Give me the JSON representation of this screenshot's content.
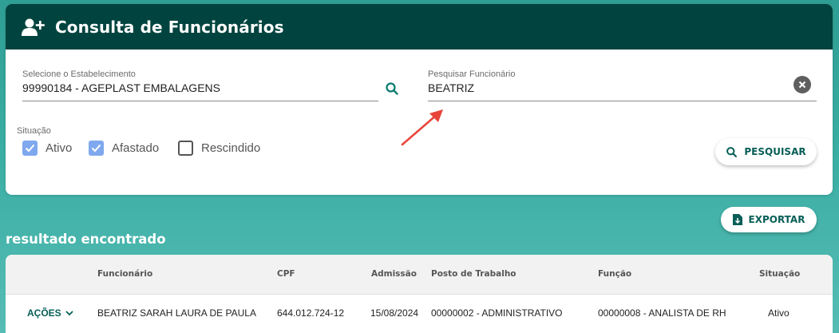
{
  "header": {
    "title": "Consulta de Funcionários",
    "icon": "user-plus-icon"
  },
  "filters": {
    "establishment": {
      "label": "Selecione o Estabelecimento",
      "value": "99990184 - AGEPLAST EMBALAGENS"
    },
    "employee": {
      "label": "Pesquisar Funcionário",
      "value": "BEATRIZ"
    },
    "situation": {
      "label": "Situação",
      "options": [
        {
          "label": "Ativo",
          "checked": true
        },
        {
          "label": "Afastado",
          "checked": true
        },
        {
          "label": "Rescindido",
          "checked": false
        }
      ]
    },
    "search_button": "PESQUISAR"
  },
  "export_button": "EXPORTAR",
  "results": {
    "title": "resultado encontrado",
    "columns": [
      "Funcionário",
      "CPF",
      "Admissão",
      "Posto de Trabalho",
      "Função",
      "Situação"
    ],
    "rows": [
      {
        "actions": "AÇÕES",
        "funcionario": "BEATRIZ SARAH LAURA DE PAULA",
        "cpf": "644.012.724-12",
        "admissao": "15/08/2024",
        "posto": "00000002 - ADMINISTRATIVO",
        "funcao": "00000008 - ANALISTA DE RH",
        "situacao": "Ativo"
      }
    ]
  },
  "colors": {
    "header_bg": "#01443f",
    "accent": "#075e57",
    "checkbox": "#7fa8ee",
    "annotation_arrow": "#e8443a"
  }
}
